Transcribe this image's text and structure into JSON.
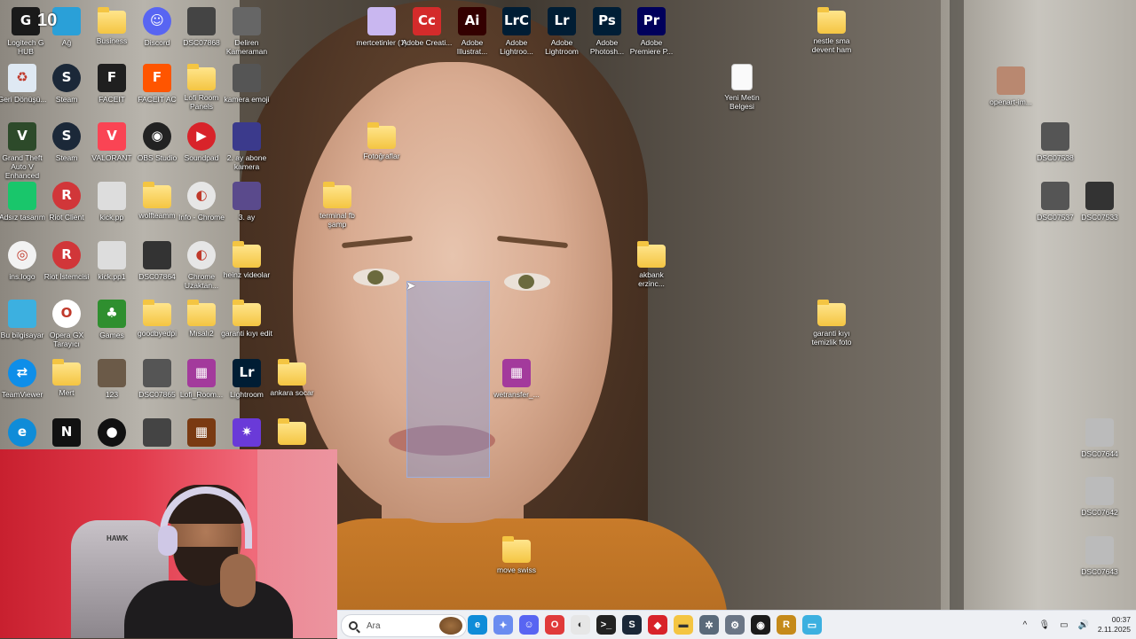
{
  "desktop_icons": [
    {
      "id": "logitech",
      "label": "Logitech G HUB",
      "kind": "app",
      "color": "#1a1a1a",
      "glyph": "G"
    },
    {
      "id": "agi",
      "label": "Ağ",
      "kind": "app",
      "color": "#2aa0d8",
      "glyph": ""
    },
    {
      "id": "business",
      "label": "Business",
      "kind": "folder",
      "color": "#f4c542",
      "glyph": ""
    },
    {
      "id": "discord",
      "label": "Discord",
      "kind": "app",
      "color": "#5865f2",
      "glyph": "☺"
    },
    {
      "id": "dsc07868",
      "label": "DSC07868",
      "kind": "thumb",
      "color": "#444",
      "glyph": ""
    },
    {
      "id": "deliren",
      "label": "Deliren Kameraman",
      "kind": "thumb",
      "color": "#666",
      "glyph": ""
    },
    {
      "id": "mertcetinler",
      "label": "mertcetinler (1)",
      "kind": "app",
      "color": "#c9b7f0",
      "glyph": ""
    },
    {
      "id": "adobe-cc",
      "label": "Adobe Creati...",
      "kind": "app",
      "color": "#d42b2b",
      "glyph": "Cc"
    },
    {
      "id": "adobe-ai",
      "label": "Adobe Illustrat...",
      "kind": "app",
      "color": "#330000",
      "glyph": "Ai"
    },
    {
      "id": "adobe-lrc",
      "label": "Adobe Lightroo...",
      "kind": "app",
      "color": "#001d34",
      "glyph": "LrC"
    },
    {
      "id": "adobe-lr",
      "label": "Adobe Lightroom",
      "kind": "app",
      "color": "#001d34",
      "glyph": "Lr"
    },
    {
      "id": "adobe-ps",
      "label": "Adobe Photosh...",
      "kind": "app",
      "color": "#001e36",
      "glyph": "Ps"
    },
    {
      "id": "adobe-pr",
      "label": "Adobe Premiere P...",
      "kind": "app",
      "color": "#00005b",
      "glyph": "Pr"
    },
    {
      "id": "nestle",
      "label": "nestle sma devent ham",
      "kind": "folder",
      "color": "#f4c542",
      "glyph": ""
    },
    {
      "id": "geri",
      "label": "Geri Dönüşü...",
      "kind": "app",
      "color": "#dfe9f3",
      "glyph": "♻"
    },
    {
      "id": "steam1",
      "label": "Steam",
      "kind": "app",
      "color": "#1b2838",
      "glyph": "S"
    },
    {
      "id": "faceit",
      "label": "FACEIT",
      "kind": "app",
      "color": "#1f1f1f",
      "glyph": "F"
    },
    {
      "id": "faceit-ac",
      "label": "FACEIT AC",
      "kind": "app",
      "color": "#ff5500",
      "glyph": "F"
    },
    {
      "id": "lofi",
      "label": "Lofi Room Panels",
      "kind": "folder",
      "color": "#f4c542",
      "glyph": ""
    },
    {
      "id": "kamera-emoji",
      "label": "kamera emoji",
      "kind": "thumb",
      "color": "#555",
      "glyph": ""
    },
    {
      "id": "yeni-metin",
      "label": "Yeni Metin Belgesi",
      "kind": "doc",
      "color": "#fafafa",
      "glyph": ""
    },
    {
      "id": "openart",
      "label": "openart-im...",
      "kind": "thumb",
      "color": "#b98870",
      "glyph": ""
    },
    {
      "id": "gta",
      "label": "Grand Theft Auto V Enhanced",
      "kind": "app",
      "color": "#2d4a2a",
      "glyph": "V"
    },
    {
      "id": "steam2",
      "label": "Steam",
      "kind": "app",
      "color": "#1b2838",
      "glyph": "S"
    },
    {
      "id": "valorant",
      "label": "VALORANT",
      "kind": "app",
      "color": "#fa4454",
      "glyph": "V"
    },
    {
      "id": "obs",
      "label": "OBS Studio",
      "kind": "app",
      "color": "#222",
      "glyph": "◉"
    },
    {
      "id": "soundpad",
      "label": "Soundpad",
      "kind": "app",
      "color": "#d8232a",
      "glyph": "▶"
    },
    {
      "id": "abone-kamera",
      "label": "2. ay abone kamera",
      "kind": "thumb",
      "color": "#3b3a8c",
      "glyph": ""
    },
    {
      "id": "fotograflar",
      "label": "Fotoğraflar",
      "kind": "folder",
      "color": "#f4c542",
      "glyph": ""
    },
    {
      "id": "dsc07538",
      "label": "DSC07538",
      "kind": "thumb",
      "color": "#555",
      "glyph": ""
    },
    {
      "id": "adsiz",
      "label": "Adsız tasarım",
      "kind": "app",
      "color": "#19c66b",
      "glyph": ""
    },
    {
      "id": "riot",
      "label": "Riot Client",
      "kind": "app",
      "color": "#d13639",
      "glyph": "R"
    },
    {
      "id": "kickpp",
      "label": "kick.pp",
      "kind": "thumb",
      "color": "#ddd",
      "glyph": ""
    },
    {
      "id": "wolfteam",
      "label": "wolfteamm",
      "kind": "folder",
      "color": "#f4c542",
      "glyph": ""
    },
    {
      "id": "info-chrome",
      "label": "Info - Chrome",
      "kind": "app",
      "color": "#e6e6e6",
      "glyph": "◐"
    },
    {
      "id": "ay3",
      "label": "3. ay",
      "kind": "thumb",
      "color": "#5a4a8c",
      "glyph": ""
    },
    {
      "id": "terminal",
      "label": "terminal fb şamp",
      "kind": "folder",
      "color": "#f4c542",
      "glyph": ""
    },
    {
      "id": "dsc07537",
      "label": "DSC07537",
      "kind": "thumb",
      "color": "#555",
      "glyph": ""
    },
    {
      "id": "dsc07533",
      "label": "DSC07533",
      "kind": "thumb",
      "color": "#333",
      "glyph": ""
    },
    {
      "id": "inslogo",
      "label": "ins.logo",
      "kind": "app",
      "color": "#f2f2f2",
      "glyph": "◎"
    },
    {
      "id": "riot-istemci",
      "label": "Riot İstemcisi",
      "kind": "app",
      "color": "#d13639",
      "glyph": "R"
    },
    {
      "id": "kickpp1",
      "label": "kick.pp1",
      "kind": "thumb",
      "color": "#ddd",
      "glyph": ""
    },
    {
      "id": "dsc07864",
      "label": "DSC07864",
      "kind": "thumb",
      "color": "#333",
      "glyph": ""
    },
    {
      "id": "chrome-uzak",
      "label": "Chrome Uzaktan...",
      "kind": "app",
      "color": "#e6e6e6",
      "glyph": "◐"
    },
    {
      "id": "heinz",
      "label": "heinz videolar",
      "kind": "folder",
      "color": "#f4c542",
      "glyph": ""
    },
    {
      "id": "akbank",
      "label": "akbank erzinc...",
      "kind": "folder",
      "color": "#f4c542",
      "glyph": ""
    },
    {
      "id": "bu-bilgisayar",
      "label": "Bu bilgisayar",
      "kind": "app",
      "color": "#3cb0e0",
      "glyph": ""
    },
    {
      "id": "opera",
      "label": "Opera GX Tarayıcı",
      "kind": "app",
      "color": "#fff",
      "glyph": "O"
    },
    {
      "id": "games",
      "label": "Games",
      "kind": "app",
      "color": "#2f8f2f",
      "glyph": "♣"
    },
    {
      "id": "goodbye",
      "label": "goodbyedpi",
      "kind": "folder",
      "color": "#f4c542",
      "glyph": ""
    },
    {
      "id": "misali2",
      "label": "Mısalı2",
      "kind": "folder",
      "color": "#f4c542",
      "glyph": ""
    },
    {
      "id": "garanti-edit",
      "label": "garanti kıyı edit",
      "kind": "folder",
      "color": "#f4c542",
      "glyph": ""
    },
    {
      "id": "garanti-foto",
      "label": "garanti kıyı temizlik foto",
      "kind": "folder",
      "color": "#f4c542",
      "glyph": ""
    },
    {
      "id": "teamviewer",
      "label": "TeamViewer",
      "kind": "app",
      "color": "#0e8ee9",
      "glyph": "⇄"
    },
    {
      "id": "mert",
      "label": "Mert",
      "kind": "folder",
      "color": "#f4c542",
      "glyph": ""
    },
    {
      "id": "i23",
      "label": "123",
      "kind": "thumb",
      "color": "#6b5a48",
      "glyph": ""
    },
    {
      "id": "dsc07865",
      "label": "DSC07865",
      "kind": "thumb",
      "color": "#555",
      "glyph": ""
    },
    {
      "id": "lofi-room",
      "label": "Lofi_Room...",
      "kind": "app",
      "color": "#a33a9c",
      "glyph": "▦"
    },
    {
      "id": "lightroom-app",
      "label": "Lightroom",
      "kind": "app",
      "color": "#001d34",
      "glyph": "Lr"
    },
    {
      "id": "ankara",
      "label": "ankara socar",
      "kind": "folder",
      "color": "#f4c542",
      "glyph": ""
    },
    {
      "id": "wetransfer",
      "label": "wetransfer_...",
      "kind": "app",
      "color": "#a33a9c",
      "glyph": "▦"
    },
    {
      "id": "dsc07644",
      "label": "DSC07644",
      "kind": "thumb",
      "color": "#bbb",
      "glyph": ""
    },
    {
      "id": "edge",
      "label": "",
      "kind": "app",
      "color": "#0f8cd8",
      "glyph": "e"
    },
    {
      "id": "netflix",
      "label": "",
      "kind": "app",
      "color": "#111",
      "glyph": "N"
    },
    {
      "id": "rec",
      "label": "",
      "kind": "app",
      "color": "#111",
      "glyph": "●"
    },
    {
      "id": "thumb-a",
      "label": "",
      "kind": "thumb",
      "color": "#444",
      "glyph": ""
    },
    {
      "id": "thumb-b",
      "label": "",
      "kind": "app",
      "color": "#7a3a12",
      "glyph": "▦"
    },
    {
      "id": "thumb-c",
      "label": "",
      "kind": "app",
      "color": "#6a3ad8",
      "glyph": "✷"
    },
    {
      "id": "folder-x",
      "label": "",
      "kind": "folder",
      "color": "#f4c542",
      "glyph": ""
    },
    {
      "id": "dsc07642",
      "label": "DSC07642",
      "kind": "thumb",
      "color": "#bbb",
      "glyph": ""
    },
    {
      "id": "move-swiss",
      "label": "move swiss",
      "kind": "folder",
      "color": "#f4c542",
      "glyph": ""
    },
    {
      "id": "dsc07643",
      "label": "DSC07643",
      "kind": "thumb",
      "color": "#bbb",
      "glyph": ""
    }
  ],
  "overlay_badge": "10",
  "webcam": {
    "chair_text": "HAWK"
  },
  "taskbar": {
    "search_placeholder": "Ara",
    "apps": [
      {
        "id": "edge",
        "color": "#0f8cd8",
        "glyph": "e"
      },
      {
        "id": "copilot",
        "color": "#6a8cf0",
        "glyph": "✦"
      },
      {
        "id": "discord",
        "color": "#5865f2",
        "glyph": "☺"
      },
      {
        "id": "opera",
        "color": "#e03a3a",
        "glyph": "O"
      },
      {
        "id": "chrome",
        "color": "#e6e6e6",
        "glyph": "◐"
      },
      {
        "id": "terminal",
        "color": "#222",
        "glyph": ">_"
      },
      {
        "id": "steam",
        "color": "#1b2838",
        "glyph": "S"
      },
      {
        "id": "app-red",
        "color": "#d8232a",
        "glyph": "◆"
      },
      {
        "id": "explorer",
        "color": "#f4c542",
        "glyph": "▬"
      },
      {
        "id": "app-gear2",
        "color": "#5a6a7a",
        "glyph": "✲"
      },
      {
        "id": "settings",
        "color": "#6b7686",
        "glyph": "⚙"
      },
      {
        "id": "app-games",
        "color": "#1b1b1b",
        "glyph": "◉"
      },
      {
        "id": "app-r",
        "color": "#c58a1a",
        "glyph": "R"
      },
      {
        "id": "app-win",
        "color": "#3cb0e0",
        "glyph": "▭"
      }
    ],
    "tray": {
      "chevron": "^",
      "mic": "🎙",
      "display": "▭",
      "speaker": "🔊"
    },
    "time": "00:37",
    "date": "2.11.2025"
  }
}
